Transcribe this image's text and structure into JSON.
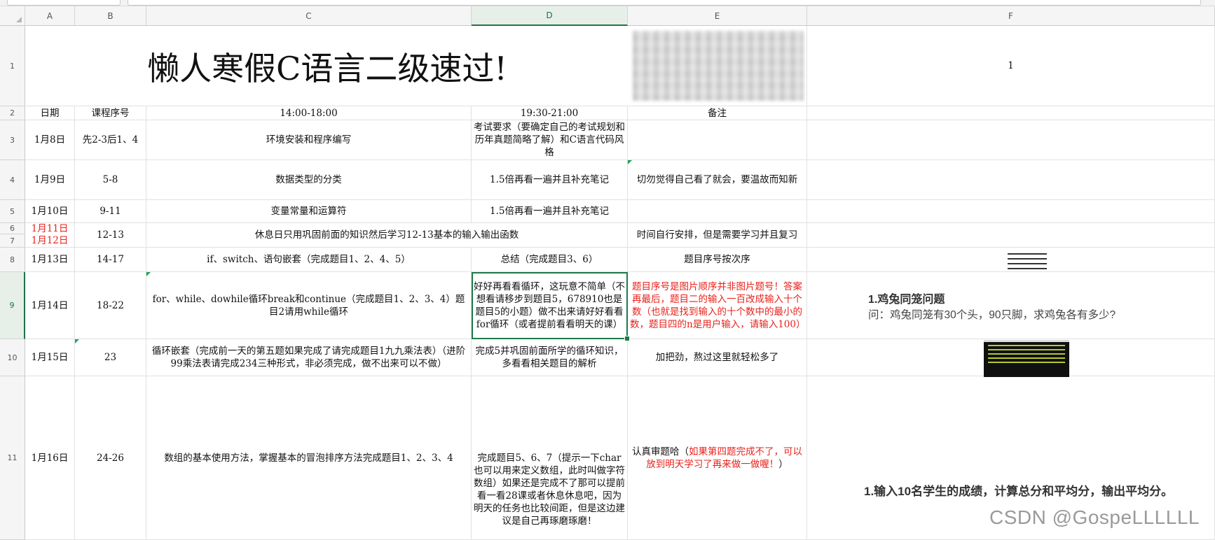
{
  "columns": [
    "A",
    "B",
    "C",
    "D",
    "E",
    "F"
  ],
  "rows": [
    "1",
    "2",
    "3",
    "4",
    "5",
    "6",
    "7",
    "8",
    "9",
    "10",
    "11"
  ],
  "title": "懒人寒假C语言二级速过!",
  "f1_value": "1",
  "header": {
    "date": "日期",
    "lesson": "课程序号",
    "afternoon": "14:00-18:00",
    "evening": "19:30-21:00",
    "notes": "备注"
  },
  "schedule": [
    {
      "date": "1月8日",
      "lesson": "先2-3后1、4",
      "afternoon": "环境安装和程序编写",
      "evening": "考试要求（要确定自己的考试规划和历年真题简略了解）和C语言代码风格",
      "notes": ""
    },
    {
      "date": "1月9日",
      "lesson": "5-8",
      "afternoon": "数据类型的分类",
      "evening": "1.5倍再看一遍并且补充笔记",
      "notes": "切勿觉得自己看了就会，要温故而知新"
    },
    {
      "date": "1月10日",
      "lesson": "9-11",
      "afternoon": "变量常量和运算符",
      "evening": "1.5倍再看一遍并且补充笔记",
      "notes": ""
    },
    {
      "date": "1月11日",
      "date2": "1月12日",
      "lesson": "12-13",
      "merged": "休息日只用巩固前面的知识然后学习12-13基本的输入输出函数",
      "notes": "时间自行安排，但是需要学习并且复习"
    },
    {
      "date": "1月13日",
      "lesson": "14-17",
      "afternoon": "if、switch、语句嵌套（完成题目1、2、4、5）",
      "evening": "总结（完成题目3、6）",
      "notes": "题目序号按次序"
    },
    {
      "date": "1月14日",
      "lesson": "18-22",
      "afternoon": "for、while、dowhile循环break和continue（完成题目1、2、3、4）题目2请用while循环",
      "evening": "好好再看看循环，这玩意不简单（不想看请移步到题目5，678910也是题目5的小题）做不出来请好好看看for循环（或者提前看看明天的课）",
      "notes": "题目序号是图片顺序并非图片题号！答案再最后，题目二的输入一百改成输入十个数（也就是找到输入的十个数中的最小的数，题目四的n是用户输入，请输入100）"
    },
    {
      "date": "1月15日",
      "lesson": "23",
      "afternoon": "循环嵌套（完成前一天的第五题如果完成了请完成题目1九九乘法表）（进阶99乘法表请完成234三种形式，非必须完成，做不出来可以不做）",
      "evening": "完成5并巩固前面所学的循环知识，多看看相关题目的解析",
      "notes": "加把劲，熬过这里就轻松多了"
    },
    {
      "date": "1月16日",
      "lesson": "24-26",
      "afternoon": "数组的基本使用方法，掌握基本的冒泡排序方法完成题目1、2、3、4",
      "evening": "完成题目5、6、7（提示一下char也可以用来定义数组，此时叫做字符数组）如果还是完成不了那可以提前看一看28课或者休息休息吧，因为明天的任务也比较间距，但是这边建议是自己再琢磨琢磨！",
      "notes_prefix": "认真审题哈（",
      "notes_red": "如果第四题完成不了，可以放到明天学习了再来做一做喔！",
      "notes_suffix": "）"
    }
  ],
  "problems": {
    "p1_title": "1.鸡兔同笼问题",
    "p1_text": "问：鸡兔同笼有30个头，90只脚，求鸡兔各有多少?",
    "p2": "1.输入10名学生的成绩，计算总分和平均分，输出平均分。"
  },
  "watermark": "CSDN @GospeLLLLLL",
  "colors": {
    "selection": "#1e7a4a",
    "red_text": "#e8221b",
    "header_bg": "#f5f5f5"
  }
}
